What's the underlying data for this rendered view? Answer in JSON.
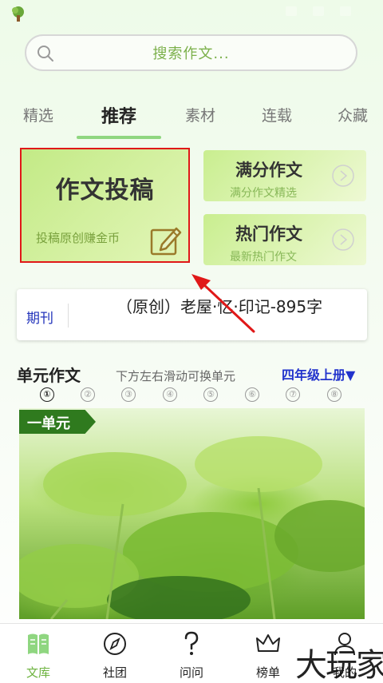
{
  "search": {
    "placeholder": "搜索作文..."
  },
  "tabs": [
    {
      "label": "精选"
    },
    {
      "label": "推荐",
      "active": true
    },
    {
      "label": "素材"
    },
    {
      "label": "连载"
    },
    {
      "label": "众藏"
    }
  ],
  "main_card": {
    "title": "作文投稿",
    "subtitle": "投稿原创赚金币",
    "icon": "edit-icon"
  },
  "side_cards": [
    {
      "title": "满分作文",
      "subtitle": "满分作文精选",
      "icon": "arrow-right-circle-icon"
    },
    {
      "title": "热门作文",
      "subtitle": "最新热门作文",
      "icon": "arrow-right-circle-icon"
    }
  ],
  "journal": {
    "label": "期刊",
    "headline": "（原创）老屋·忆·印记-895字"
  },
  "units": {
    "title": "单元作文",
    "hint": "下方左右滑动可换单元",
    "grade": "四年级上册▼",
    "numbers": [
      "①",
      "②",
      "③",
      "④",
      "⑤",
      "⑥",
      "⑦",
      "⑧"
    ],
    "active_index": 0,
    "banner_tag": "一单元"
  },
  "bottom_nav": [
    {
      "label": "文库",
      "icon": "book-icon",
      "active": true
    },
    {
      "label": "社团",
      "icon": "compass-icon"
    },
    {
      "label": "问问",
      "icon": "question-icon"
    },
    {
      "label": "榜单",
      "icon": "crown-icon"
    },
    {
      "label": "我的",
      "icon": "profile-icon"
    }
  ],
  "watermark": "大玩家",
  "colors": {
    "accent_green": "#8fd680",
    "highlight_red": "#e01818",
    "link_blue": "#2233cc"
  }
}
